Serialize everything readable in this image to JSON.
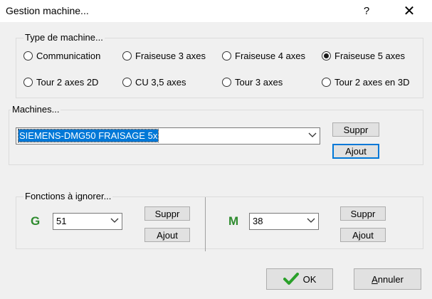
{
  "window": {
    "title": "Gestion machine...",
    "help_label": "?",
    "close_label": "✕"
  },
  "machine_type": {
    "legend": "Type de machine...",
    "options": [
      {
        "label": "Communication",
        "checked": false
      },
      {
        "label": "Fraiseuse 3 axes",
        "checked": false
      },
      {
        "label": "Fraiseuse 4 axes",
        "checked": false
      },
      {
        "label": "Fraiseuse 5 axes",
        "checked": true
      },
      {
        "label": "Tour 2 axes 2D",
        "checked": false
      },
      {
        "label": "CU 3,5 axes",
        "checked": false
      },
      {
        "label": "Tour 3 axes",
        "checked": false
      },
      {
        "label": "Tour 2 axes en 3D",
        "checked": false
      }
    ]
  },
  "machines": {
    "legend": "Machines...",
    "selected": "SIEMENS-DMG50 FRAISAGE 5x",
    "delete_label": "Suppr",
    "add_label": "Ajout"
  },
  "ignore": {
    "legend": "Fonctions à ignorer...",
    "g": {
      "letter": "G",
      "value": "51",
      "delete_label": "Suppr",
      "add_label": "Ajout"
    },
    "m": {
      "letter": "M",
      "value": "38",
      "delete_label": "Suppr",
      "add_label": "Ajout"
    }
  },
  "footer": {
    "ok_label": "OK",
    "cancel_label": "Annuler",
    "cancel_mnemonic": "A",
    "cancel_rest": "nnuler"
  },
  "colors": {
    "accent": "#0078d7",
    "gm_green": "#2e8b2e",
    "ok_check": "#2aa02a"
  }
}
